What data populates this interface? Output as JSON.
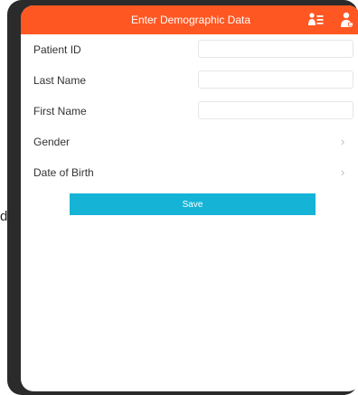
{
  "stray_text": "d",
  "header": {
    "title": "Enter Demographic Data",
    "patient_list_icon": "patient-list-icon",
    "user_icon": "user-icon",
    "color": "#ff5722"
  },
  "form": {
    "fields": [
      {
        "label": "Patient ID",
        "value": "",
        "placeholder": ""
      },
      {
        "label": "Last Name",
        "value": "",
        "placeholder": ""
      },
      {
        "label": "First Name",
        "value": "",
        "placeholder": ""
      }
    ],
    "selects": [
      {
        "label": "Gender",
        "chevron": "›"
      },
      {
        "label": "Date of Birth",
        "chevron": "›"
      }
    ],
    "save_label": "Save",
    "save_color": "#15b3d6"
  }
}
